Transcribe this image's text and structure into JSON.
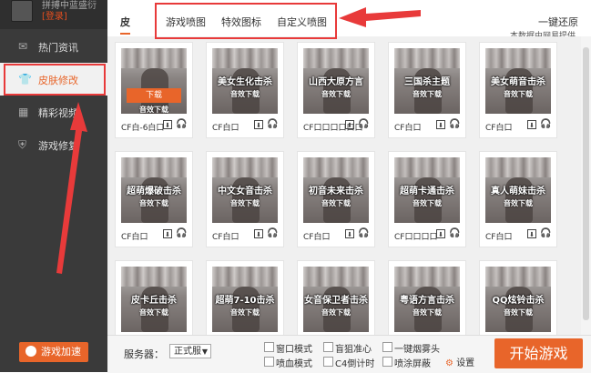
{
  "sidebar": {
    "account_label": "拼搏中蓝盛衍",
    "login_label": "[登录]",
    "items": [
      {
        "label": "热门资讯",
        "icon": "mail-icon"
      },
      {
        "label": "皮肤修改",
        "icon": "shirt-icon"
      },
      {
        "label": "精彩视频",
        "icon": "film-icon"
      },
      {
        "label": "游戏修复",
        "icon": "shield-icon"
      }
    ],
    "accelerate_label": "游戏加速"
  },
  "tabs": [
    {
      "label": "皮"
    },
    {
      "label": "游戏喷图"
    },
    {
      "label": "特效图标"
    },
    {
      "label": "自定义喷图"
    }
  ],
  "header": {
    "restore_label": "一键还原",
    "provider_label": "本数据由网易提供"
  },
  "cards": [
    {
      "name": "",
      "caption": "CF白-6白口",
      "download_text": "音效下载",
      "button": "下载"
    },
    {
      "name": "美女生化击杀",
      "caption": "CF白口",
      "download_text": "音效下载"
    },
    {
      "name": "山西大原方言",
      "caption": "CF口口口口口口",
      "download_text": "音效下载"
    },
    {
      "name": "三国杀主题",
      "caption": "CF白口",
      "download_text": "音效下载"
    },
    {
      "name": "美女萌音击杀",
      "caption": "CF白口",
      "download_text": "音效下载"
    },
    {
      "name": "超萌爆破击杀",
      "caption": "CF白口",
      "download_text": "音效下载"
    },
    {
      "name": "中文女音击杀",
      "caption": "CF白口",
      "download_text": "音效下载"
    },
    {
      "name": "初音未来击杀",
      "caption": "CF白口",
      "download_text": "音效下载"
    },
    {
      "name": "超萌卡通击杀",
      "caption": "CF口口口口",
      "download_text": "音效下载"
    },
    {
      "name": "真人萌妹击杀",
      "caption": "CF白口",
      "download_text": "音效下载"
    },
    {
      "name": "皮卡丘击杀",
      "caption": "",
      "download_text": "音效下载"
    },
    {
      "name": "超萌7-10击杀",
      "caption": "",
      "download_text": "音效下载"
    },
    {
      "name": "女音保卫者击杀",
      "caption": "",
      "download_text": "音效下载"
    },
    {
      "name": "粤语方言击杀",
      "caption": "",
      "download_text": "音效下载"
    },
    {
      "name": "QQ炫铃击杀",
      "caption": "",
      "download_text": "音效下载"
    }
  ],
  "bottom": {
    "server_label": "服务器：",
    "server_value": "正式服",
    "options": [
      {
        "label": "窗口模式"
      },
      {
        "label": "盲狙准心"
      },
      {
        "label": "一键烟雾头"
      },
      {
        "label": "喷血模式"
      },
      {
        "label": "C4倒计时"
      },
      {
        "label": "喷涂屏蔽"
      }
    ],
    "settings_label": "设置",
    "start_label": "开始游戏"
  },
  "colors": {
    "accent": "#e8652a",
    "annotation_red": "#e83a3a",
    "sidebar_bg": "#3a3a3a"
  }
}
